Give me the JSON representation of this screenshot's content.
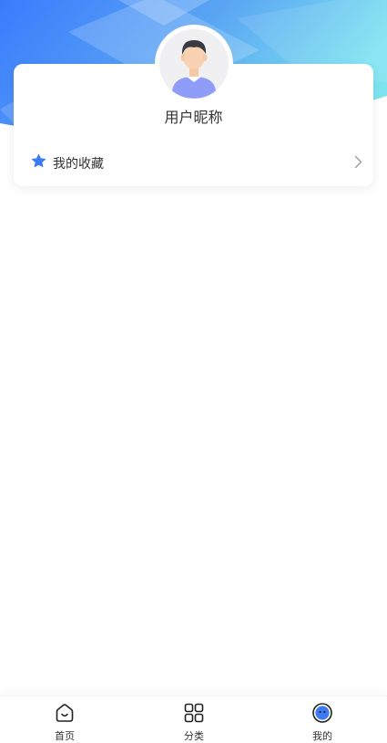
{
  "profile": {
    "nickname": "用户昵称"
  },
  "menu": {
    "favorites_label": "我的收藏",
    "favorites_icon": "star-icon",
    "accent": "#3d7bf5"
  },
  "tabbar": {
    "tabs": [
      {
        "label": "首页",
        "icon": "home-icon"
      },
      {
        "label": "分类",
        "icon": "category-grid-icon"
      },
      {
        "label": "我的",
        "icon": "profile-icon",
        "active": true
      }
    ]
  },
  "colors": {
    "hero_left": "#3a7bfd",
    "hero_right": "#7ce3f0"
  }
}
